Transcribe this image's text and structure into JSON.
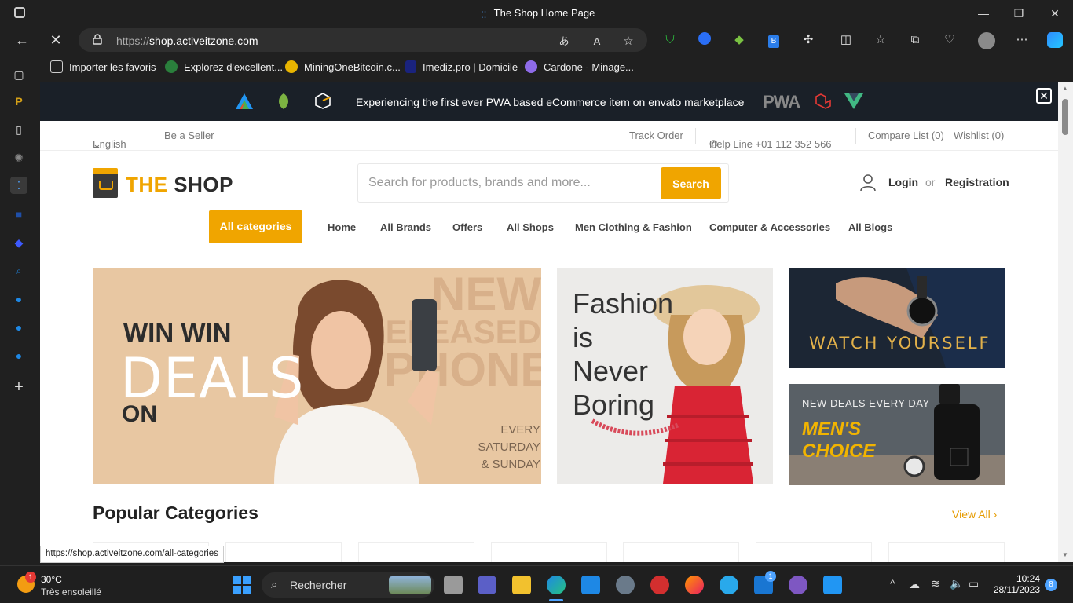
{
  "window": {
    "title": "The Shop Home Page"
  },
  "addressbar": {
    "scheme": "https://",
    "host": "shop.activeitzone.com"
  },
  "favorites": [
    {
      "label": "Importer les favoris"
    },
    {
      "label": "Explorez d'excellent..."
    },
    {
      "label": "MiningOneBitcoin.c..."
    },
    {
      "label": "Imediz.pro | Domicile"
    },
    {
      "label": "Cardone - Minage..."
    }
  ],
  "promo": {
    "text": "Experiencing the first ever PWA based eCommerce item on envato marketplace",
    "pwa_label": "PWA"
  },
  "topbar": {
    "language": "English",
    "seller": "Be a Seller",
    "track": "Track Order",
    "helpline": "Help Line +01 112 352 566",
    "compare": "Compare List (0)",
    "wishlist": "Wishlist (0)"
  },
  "logo": {
    "part1": "THE",
    "part2": "SHOP"
  },
  "search": {
    "placeholder": "Search for products, brands and more...",
    "button": "Search"
  },
  "auth": {
    "login": "Login",
    "or": "or",
    "register": "Registration"
  },
  "nav": {
    "all_categories": "All categories",
    "links": [
      "Home",
      "All Brands",
      "Offers",
      "All Shops",
      "Men Clothing & Fashion",
      "Computer & Accessories",
      "All Blogs"
    ]
  },
  "banners": {
    "b1": {
      "l1": "WIN WIN",
      "l2": "DEALS",
      "l3": "ON",
      "bg1": "NEW",
      "bg2": "RELEASED",
      "bg3": "PHONE",
      "s1": "EVERY SATURDAY",
      "s2": "& SUNDAY"
    },
    "b2": {
      "l1": "Fashion",
      "l2": "is",
      "l3": "Never",
      "l4": "Boring"
    },
    "b3": {
      "text": "WATCH YOURSELF"
    },
    "b4": {
      "top": "NEW DEALS EVERY DAY",
      "l1": "MEN'S",
      "l2": "CHOICE"
    }
  },
  "popular": {
    "title": "Popular Categories",
    "view_all": "View All"
  },
  "status_link": "https://shop.activeitzone.com/all-categories",
  "taskbar": {
    "temp": "30°C",
    "weather": "Très ensoleillé",
    "weather_badge": "1",
    "search": "Rechercher",
    "mail_badge": "1",
    "time": "10:24",
    "date": "28/11/2023",
    "notif_count": "8"
  },
  "colors": {
    "accent": "#f0a500",
    "promo_bg": "#1a2028",
    "chrome_bg": "#202020"
  }
}
